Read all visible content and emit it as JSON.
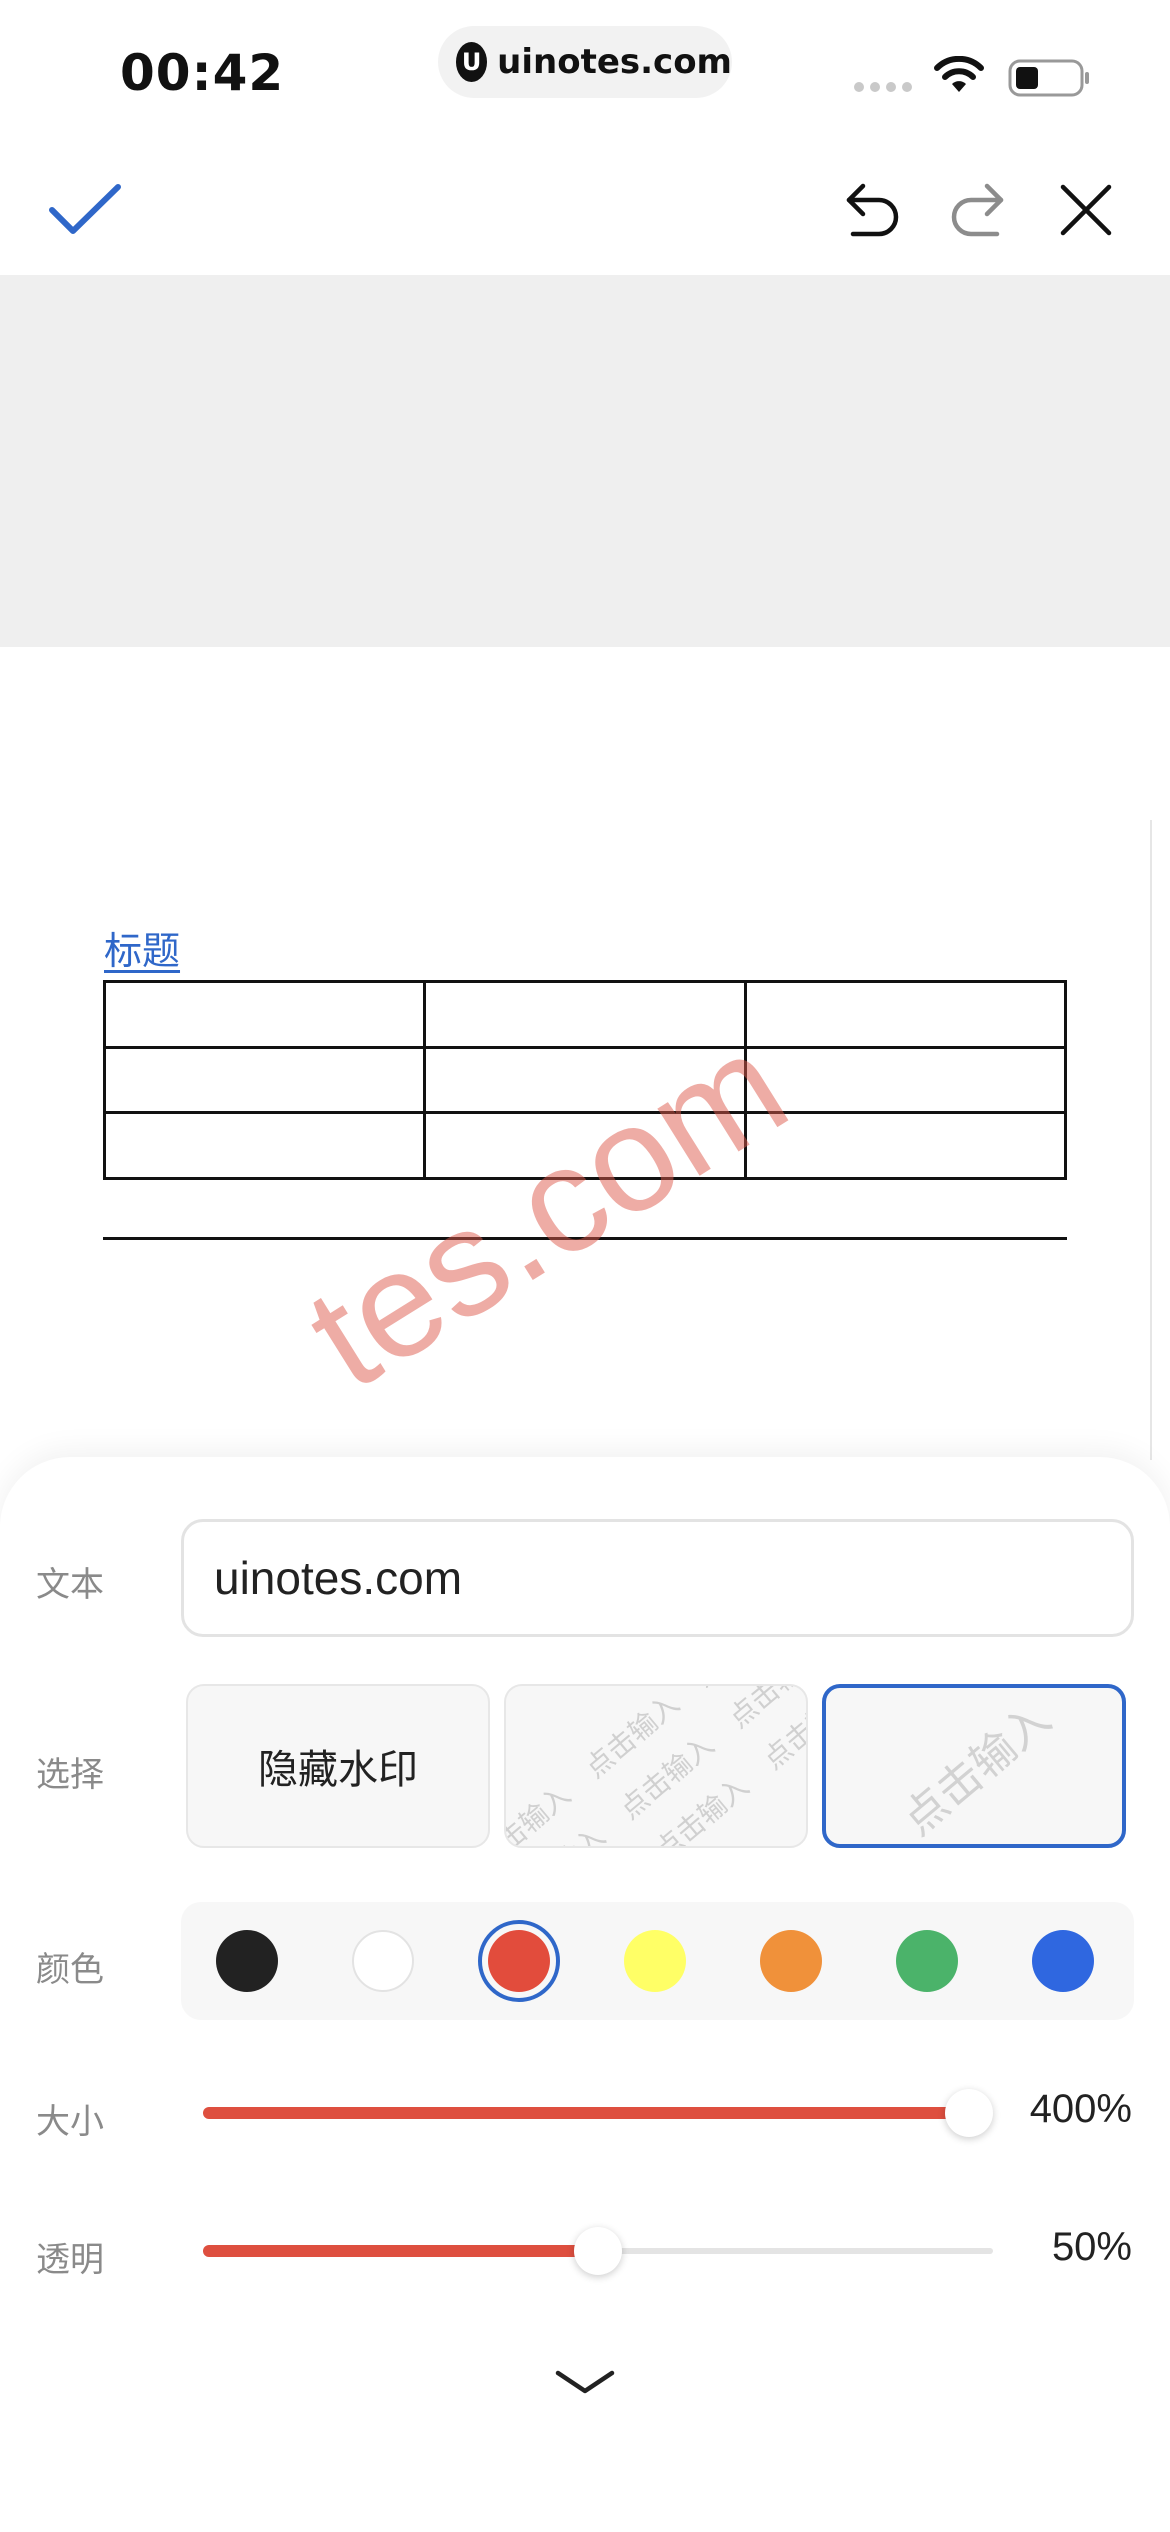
{
  "status_bar": {
    "time": "00:42",
    "url": "uinotes.com",
    "logo_letter": "U"
  },
  "toolbar": {
    "confirm_icon": "check-icon",
    "undo_icon": "undo-icon",
    "redo_icon": "redo-icon",
    "close_icon": "close-icon"
  },
  "document": {
    "title": "标题",
    "table": {
      "rows": 3,
      "cols": 3
    },
    "watermark_text": "tes.com"
  },
  "sheet": {
    "text_label": "文本",
    "text_value": "uinotes.com",
    "select_label": "选择",
    "options": {
      "hide_label": "隐藏水印",
      "tile_text": "点击输入",
      "single_text": "点击输入"
    },
    "color_label": "颜色",
    "colors": [
      "#222222",
      "#ffffff",
      "#e24c3c",
      "#ffff66",
      "#f0913a",
      "#4bb36a",
      "#2f67e0"
    ],
    "selected_color_index": 2,
    "size_label": "大小",
    "size_value": "400%",
    "size_fraction": 1.0,
    "opacity_label": "透明",
    "opacity_value": "50%",
    "opacity_fraction": 0.5,
    "collapse_icon": "chevron-down-icon",
    "accent_color": "#2f67c9",
    "slider_color": "#de4f3f"
  }
}
